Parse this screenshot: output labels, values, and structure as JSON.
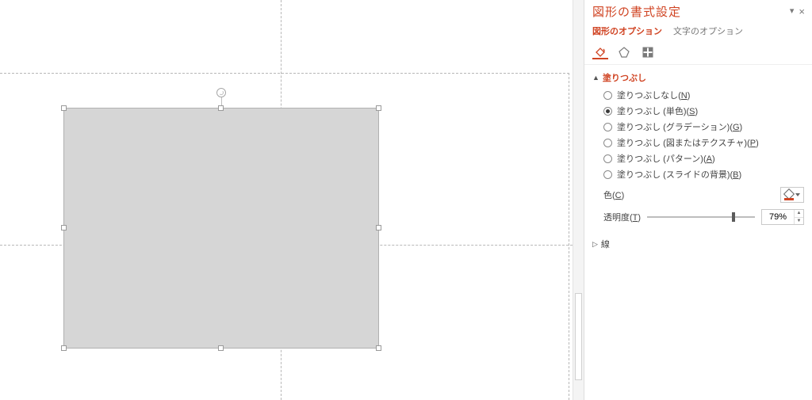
{
  "pane": {
    "title": "図形の書式設定",
    "close_label": "×",
    "menu_label": "▾",
    "tabs": {
      "shape": "図形のオプション",
      "text": "文字のオプション"
    },
    "icon_tabs": {
      "fill": "paint-bucket-icon",
      "effects": "pentagon-icon",
      "size": "size-grid-icon"
    }
  },
  "fill_section": {
    "title": "塗りつぶし",
    "options": {
      "none": {
        "label": "塗りつぶしなし(",
        "accel": "N",
        "tail": ")"
      },
      "solid": {
        "label": "塗りつぶし (単色)(",
        "accel": "S",
        "tail": ")"
      },
      "gradient": {
        "label": "塗りつぶし (グラデーション)(",
        "accel": "G",
        "tail": ")"
      },
      "picture": {
        "label": "塗りつぶし (図またはテクスチャ)(",
        "accel": "P",
        "tail": ")"
      },
      "pattern": {
        "label": "塗りつぶし (パターン)(",
        "accel": "A",
        "tail": ")"
      },
      "slidebg": {
        "label": "塗りつぶし (スライドの背景)(",
        "accel": "B",
        "tail": ")"
      }
    },
    "selected": "solid",
    "color_label_pre": "色(",
    "color_accel": "C",
    "color_label_post": ")",
    "transparency_label_pre": "透明度(",
    "transparency_accel": "T",
    "transparency_label_post": ")",
    "transparency_value": "79%",
    "transparency_pct": 79
  },
  "line_section": {
    "title": "線"
  }
}
